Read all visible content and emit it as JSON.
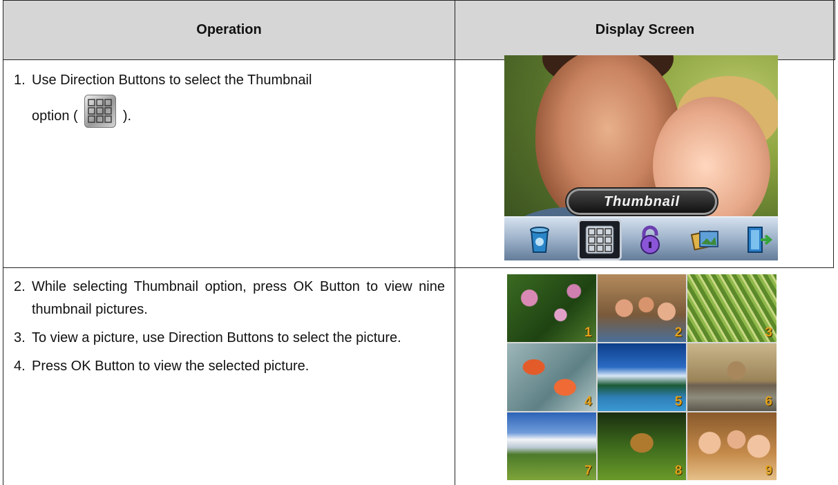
{
  "table": {
    "headers": {
      "operation": "Operation",
      "display_screen": "Display Screen"
    },
    "row1": {
      "step1_num": "1.",
      "step1_text_a": "Use Direction Buttons to select the Thumbnail",
      "step1_text_b_pre": "option (",
      "step1_text_b_post": ").",
      "icon": "thumbnail-grid-icon"
    },
    "row2": {
      "steps": [
        {
          "num": "2.",
          "text": "While selecting Thumbnail option, press OK Button to view nine thumbnail pictures."
        },
        {
          "num": "3.",
          "text": "To view a picture, use Direction Buttons to select the picture."
        },
        {
          "num": "4.",
          "text": "Press OK Button to view the selected picture."
        }
      ]
    }
  },
  "screen1": {
    "menu_label": "Thumbnail",
    "menu_icons": [
      "delete-icon",
      "thumbnail-icon",
      "protect-lock-icon",
      "slideshow-icon",
      "exit-icon"
    ],
    "selected_index": 1
  },
  "screen2": {
    "thumbnails": [
      "1",
      "2",
      "3",
      "4",
      "5",
      "6",
      "7",
      "8",
      "9"
    ]
  }
}
